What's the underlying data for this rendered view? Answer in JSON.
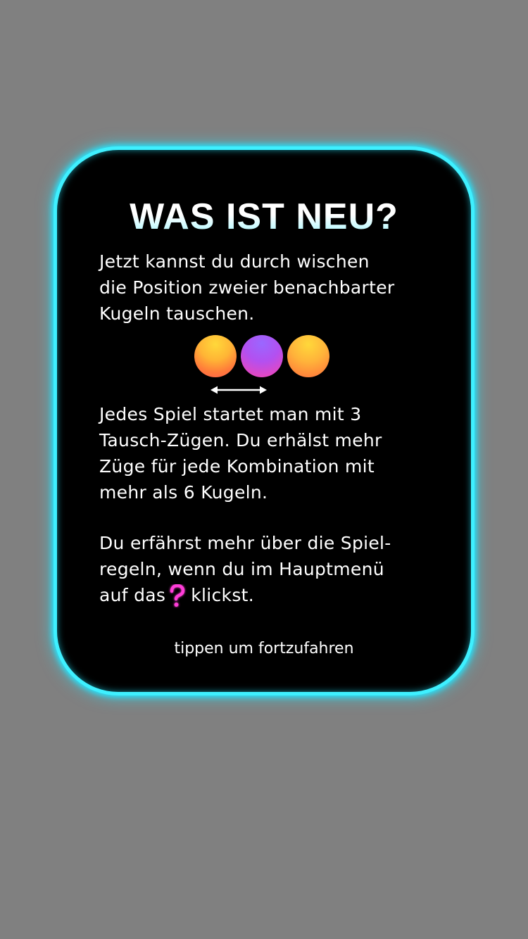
{
  "dialog": {
    "title": "WAS IST NEU?",
    "paragraph1": {
      "lines": [
        "Jetzt kannst du durch wischen",
        "die Position zweier benachbarter",
        "Kugeln tauschen."
      ]
    },
    "illustration": {
      "balls": [
        {
          "color": "orange",
          "accent": "#ffb535"
        },
        {
          "color": "purple",
          "accent": "#c04ce4"
        },
        {
          "color": "orange",
          "accent": "#ffb33a"
        }
      ],
      "arrow_icon": "double-arrow-horizontal"
    },
    "paragraph2": {
      "lines": [
        "Jedes Spiel startet man mit 3",
        "Tausch-Zügen. Du erhälst mehr",
        "Züge für jede Kombination mit",
        "mehr als 6 Kugeln."
      ]
    },
    "paragraph3": {
      "line1": "Du erfährst mehr über die Spiel-",
      "line2": "regeln, wenn du im Hauptmenü",
      "line3_before": "auf das",
      "line3_icon": "question-mark-icon",
      "line3_after": "klickst."
    },
    "continue_hint": "tippen um fortzufahren"
  },
  "colors": {
    "background": "#808080",
    "dialog_fill": "#000000",
    "dialog_glow": "#3ff0ff",
    "text": "#ffffff",
    "question_icon": "#ff3dd8"
  }
}
